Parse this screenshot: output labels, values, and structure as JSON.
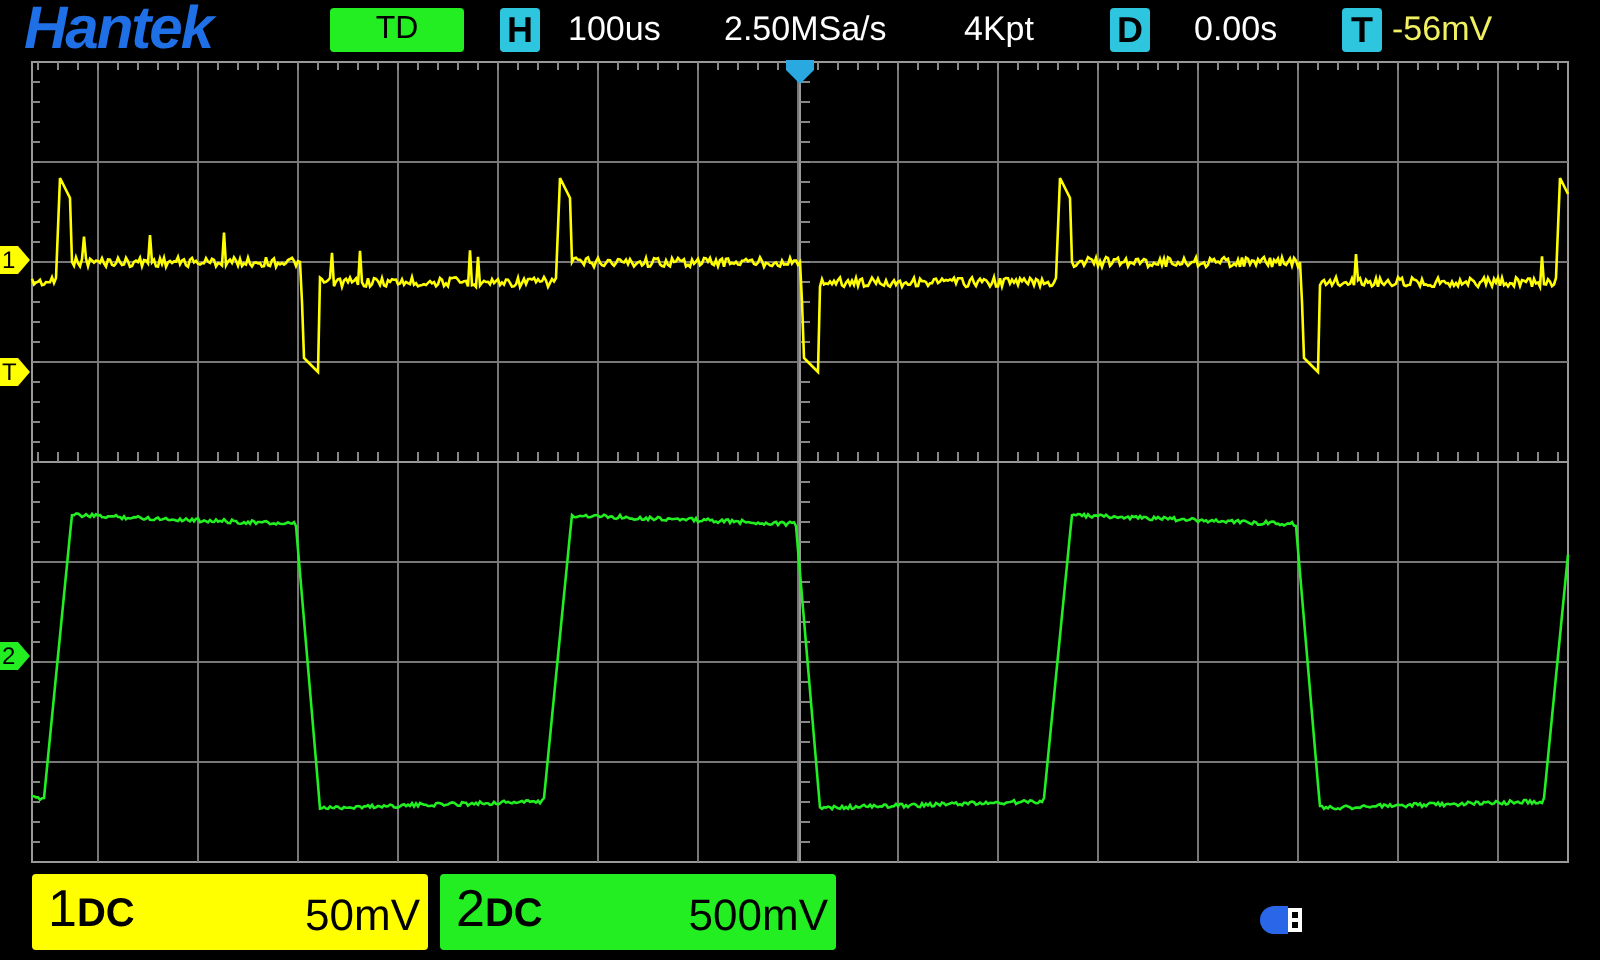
{
  "header": {
    "brand": "Hantek",
    "mode": "TD",
    "timebase": {
      "label": "H",
      "value": "100us"
    },
    "sample_rate": "2.50MSa/s",
    "memory_depth": "4Kpt",
    "delay": {
      "label": "D",
      "value": "0.00s"
    },
    "trigger": {
      "label": "T",
      "value": "-56mV"
    }
  },
  "markers": [
    {
      "label": "1",
      "kind": "channel",
      "color": "#ffff00"
    },
    {
      "label": "T",
      "kind": "trigger",
      "color": "#ffff00"
    },
    {
      "label": "2",
      "kind": "channel",
      "color": "#22ee22"
    }
  ],
  "channels": [
    {
      "number": "1",
      "coupling": "DC",
      "scale": "50mV",
      "color": "#ffff00"
    },
    {
      "number": "2",
      "coupling": "DC",
      "scale": "500mV",
      "color": "#22ee22"
    }
  ]
}
